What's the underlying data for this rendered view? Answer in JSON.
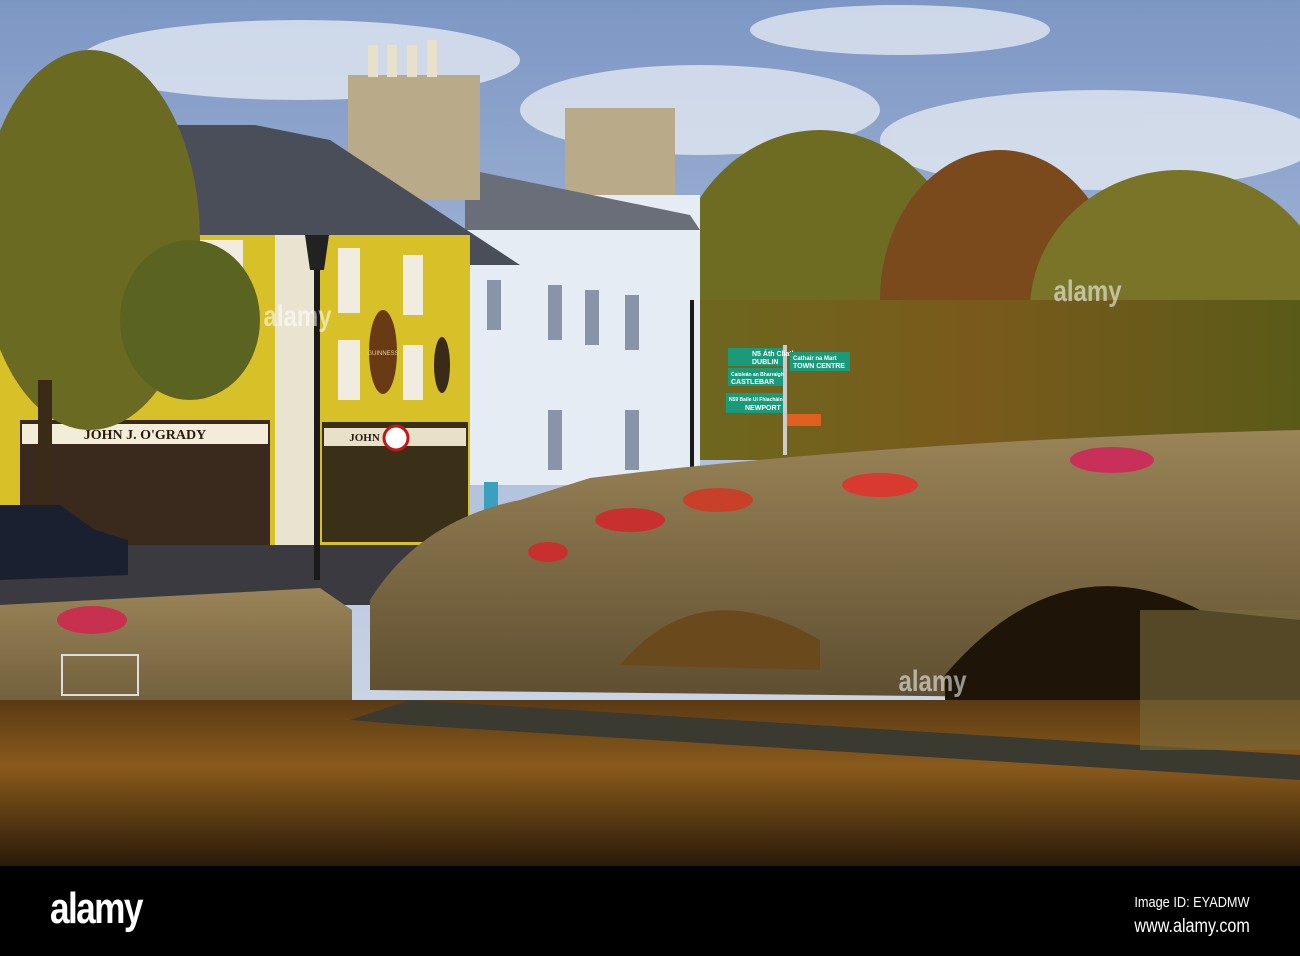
{
  "photo": {
    "shop_sign": "JOHN J. O'GRADY",
    "shop_sign_2": "JOHN J.",
    "pub_plaque": "GUINNESS",
    "signposts": [
      {
        "line1": "N5 Áth Cliath",
        "line2": "DUBLIN"
      },
      {
        "line1": "Caisleán an Bharraigh",
        "line2": "CASTLEBAR"
      },
      {
        "line1": "N59 Baile Uí Fhiacháin",
        "line2": "NEWPORT"
      },
      {
        "line1": "Cathair na Mart",
        "line2": "TOWN CENTRE"
      }
    ]
  },
  "watermark": {
    "text": "alamy"
  },
  "footer": {
    "logo": "alamy",
    "image_id": "Image ID: EYADMW",
    "url": "www.alamy.com"
  }
}
